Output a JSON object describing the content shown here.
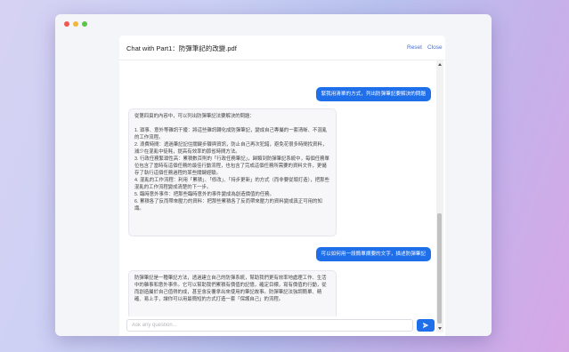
{
  "window": {
    "controls": [
      "close",
      "minimize",
      "maximize"
    ]
  },
  "header": {
    "title": "Chat with Part1：防彈筆記的改變.pdf",
    "reset_label": "Reset",
    "close_label": "Close"
  },
  "messages": [
    {
      "role": "user",
      "text": "緊我用清單的方式，列出防彈筆記要解決的問題"
    },
    {
      "role": "assistant",
      "text": "從第四頁的內容中，可以列出防彈筆記法要解決的問題：\n\n1. 瑣事、意外等雜訊干擾：將這些雜訊轉化成防彈筆記，變成自己專屬的一套清晰、不混亂的工作流程。\n2. 浪費時間：透過筆記記住關鍵步驟與資訊，防止自己再次犯錯，避免花很多時間找資料，減少在混亂中徒耗，提高有效率的節省時間方法。\n3. 行政任務繁瑣性高：累積數百則的「行政任務筆記」，歸類到防彈筆記系統中，每個任務單位包含了當時有這個任務的最佳行動流程，也包含了完成這個任務所需要的資料文件，更儲存了執行這個任務過程的某些關鍵經驗。\n4. 混亂的工作流程：利用「累積」、「修改」、「持步更新」的方式（而非要從頭打造），把那些混亂的工作流程變成清楚的下一步。\n5. 臨時意外事件：把那些臨時意外的事件變成為創造價值的任務。\n6. 累積各了反而帶來壓力的資料：把那些累積各了反而帶來壓力的資料變成真正可用的知識。"
    },
    {
      "role": "user",
      "text": "可以如何用一段簡單摘要的文字，描述防彈筆記"
    },
    {
      "role": "assistant",
      "text": "防彈筆記是一種筆記方法，透過建立自己的防彈系統，幫助我們更有效率地處理工作、生活中的雜事和意外事件。它可以幫助我們累積有價值的記憶，確定目標，寫有價值的行動，從而創造屬於自己值得的成，甚至會反覆拿出來使用的筆記故事。防彈筆記法強調簡單、精確、易上手，讓你可以用最簡短的方式打造一套「保護自己」的流程。"
    }
  ],
  "input": {
    "placeholder": "Ask any question..."
  },
  "icons": {
    "send": "send-icon"
  },
  "colors": {
    "accent": "#1f6feb",
    "link": "#4a6fd8"
  }
}
